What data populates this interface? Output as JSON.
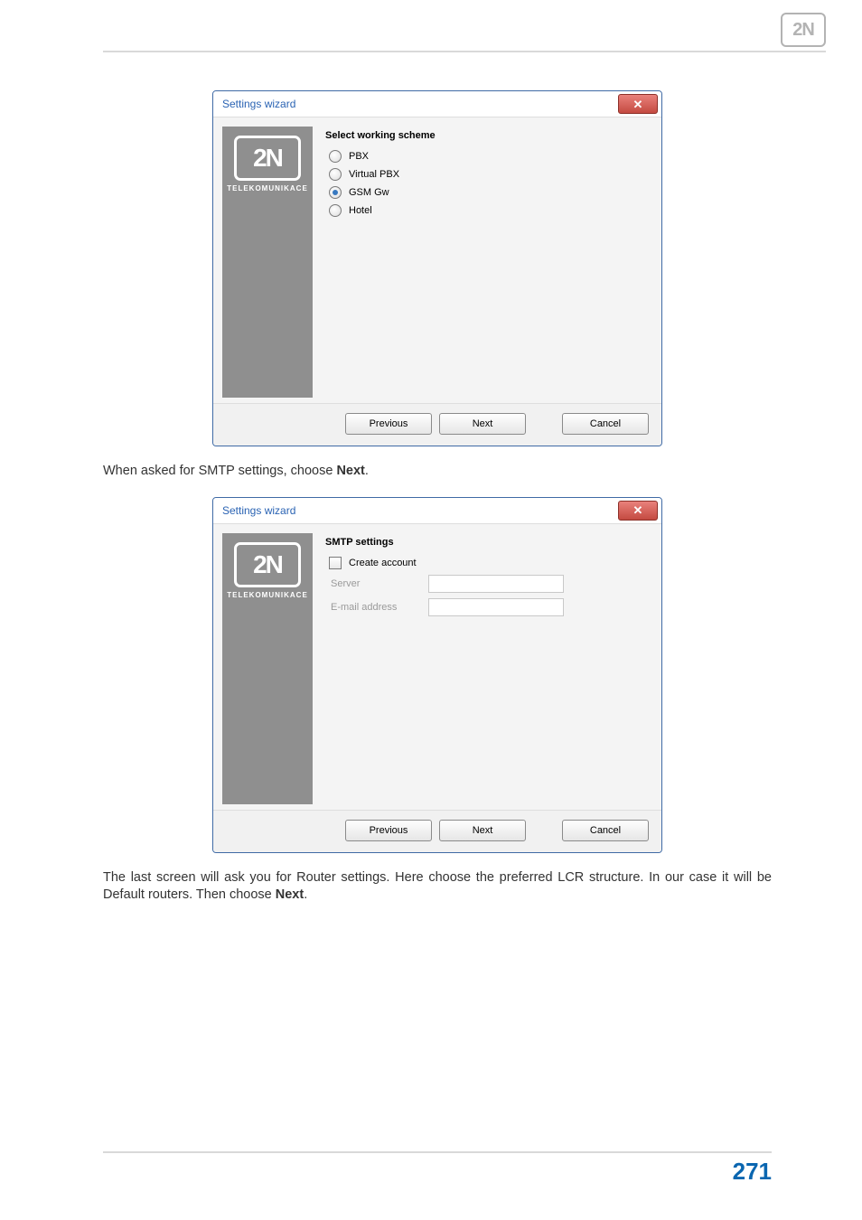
{
  "header": {
    "logo_text": "2N"
  },
  "dialog1": {
    "title": "Settings wizard",
    "close_glyph": "✕",
    "brand_text": "2N",
    "brand_sub": "TELEKOMUNIKACE",
    "heading": "Select working scheme",
    "options": {
      "pbx": "PBX",
      "vpbx": "Virtual PBX",
      "gsm": "GSM Gw",
      "hotel": "Hotel"
    },
    "buttons": {
      "prev": "Previous",
      "next": "Next",
      "cancel": "Cancel"
    }
  },
  "paragraph1": {
    "pre": "When asked for SMTP settings, choose ",
    "bold": "Next",
    "post": "."
  },
  "dialog2": {
    "title": "Settings wizard",
    "close_glyph": "✕",
    "brand_text": "2N",
    "brand_sub": "TELEKOMUNIKACE",
    "heading": "SMTP settings",
    "create_account": "Create account",
    "server_label": "Server",
    "email_label": "E-mail address",
    "buttons": {
      "prev": "Previous",
      "next": "Next",
      "cancel": "Cancel"
    }
  },
  "paragraph2": {
    "pre": "The last screen will ask you for Router settings. Here choose the preferred LCR structure. In our case it will be Default routers. Then choose ",
    "bold": "Next",
    "post": "."
  },
  "footer": {
    "page_number": "271"
  }
}
